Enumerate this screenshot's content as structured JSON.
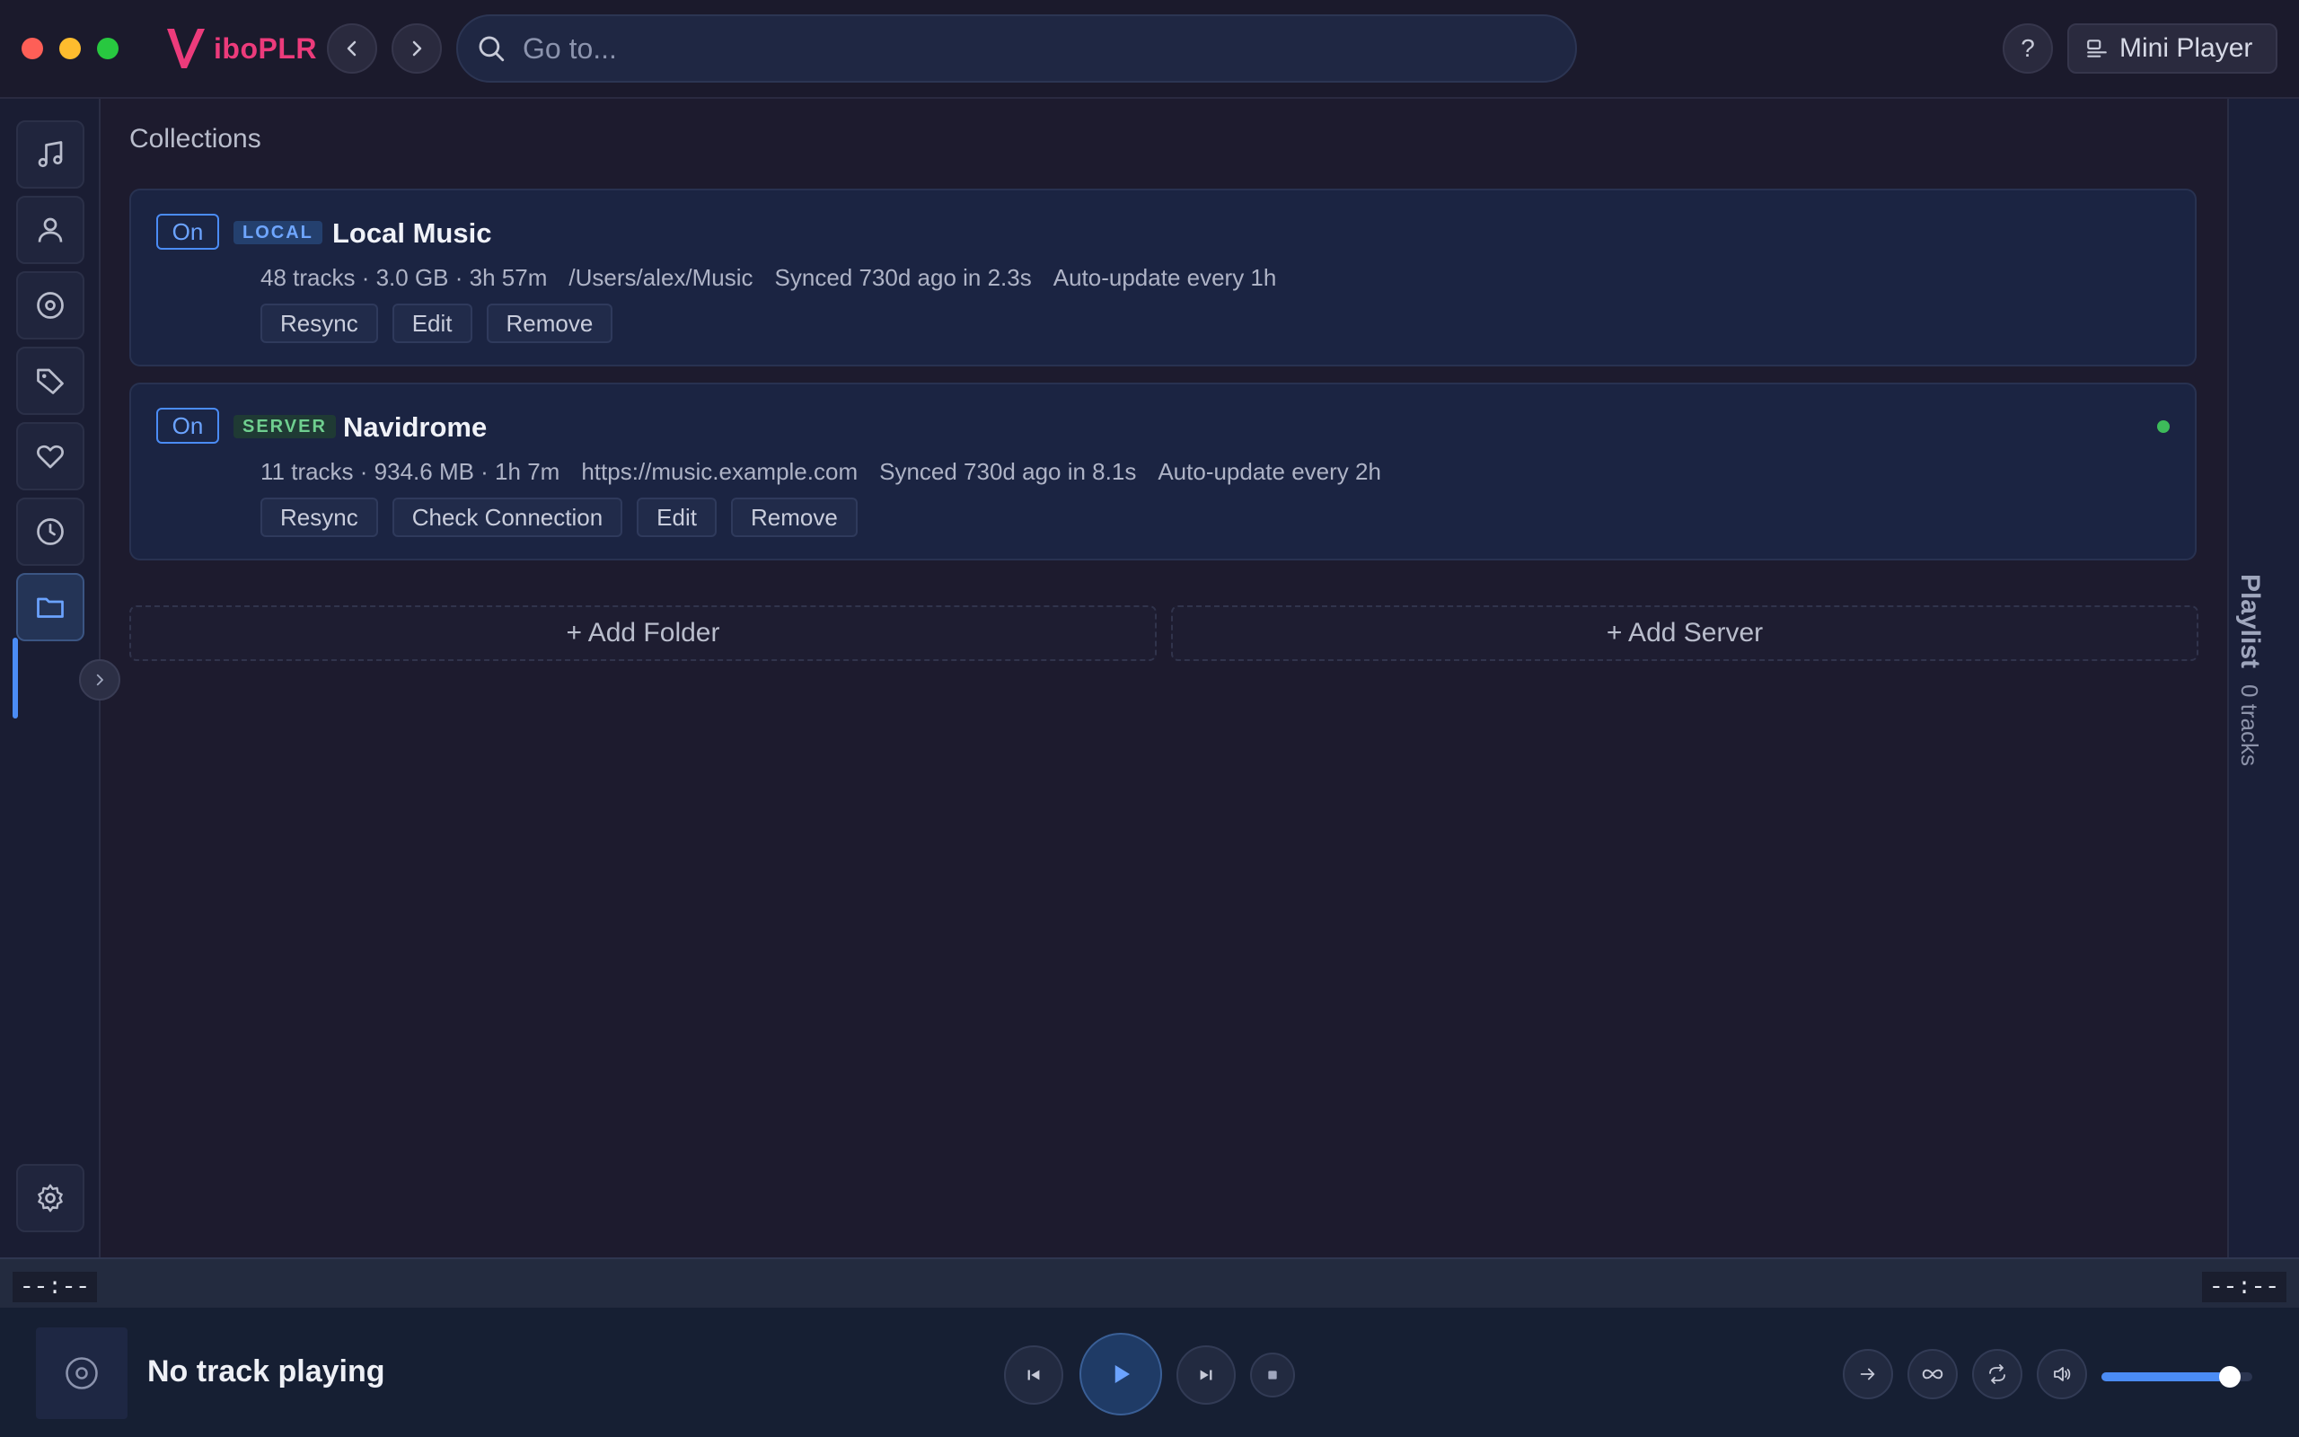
{
  "app": {
    "name": "iboPLR",
    "brand_color": "#ec3b7b",
    "accent_color": "#4b8cf5"
  },
  "header": {
    "search_placeholder": "Go to...",
    "help_label": "?",
    "mini_player_label": "Mini Player"
  },
  "sidebar": {
    "items": [
      {
        "name": "music",
        "icon": "music-note-icon"
      },
      {
        "name": "artists",
        "icon": "person-icon"
      },
      {
        "name": "albums",
        "icon": "disc-icon"
      },
      {
        "name": "tags",
        "icon": "tag-icon"
      },
      {
        "name": "favorites",
        "icon": "heart-icon"
      },
      {
        "name": "history",
        "icon": "clock-icon"
      },
      {
        "name": "collections",
        "icon": "folder-icon",
        "active": true
      }
    ],
    "settings_icon": "gear-icon"
  },
  "main": {
    "title": "Collections",
    "collections": [
      {
        "enabled_label": "On",
        "type": "LOCAL",
        "name": "Local Music",
        "stats": "48 tracks · 3.0 GB · 3h 57m",
        "location": "/Users/alex/Music",
        "synced": "Synced 730d ago in 2.3s",
        "auto_update": "Auto-update every 1h",
        "actions": [
          "Resync",
          "Edit",
          "Remove"
        ]
      },
      {
        "enabled_label": "On",
        "type": "SERVER",
        "name": "Navidrome",
        "stats": "11 tracks · 934.6 MB · 1h 7m",
        "location": "https://music.example.com",
        "synced": "Synced 730d ago in 8.1s",
        "auto_update": "Auto-update every 2h",
        "actions": [
          "Resync",
          "Check Connection",
          "Edit",
          "Remove"
        ],
        "status_color": "#3dbb5a"
      }
    ],
    "add_folder_label": "+ Add Folder",
    "add_server_label": "+ Add Server"
  },
  "playlist_panel": {
    "title": "Playlist",
    "count": "0 tracks"
  },
  "progress": {
    "elapsed": "--:--",
    "remaining": "--:--"
  },
  "player": {
    "now_playing": "No track playing",
    "volume": 0.85
  }
}
